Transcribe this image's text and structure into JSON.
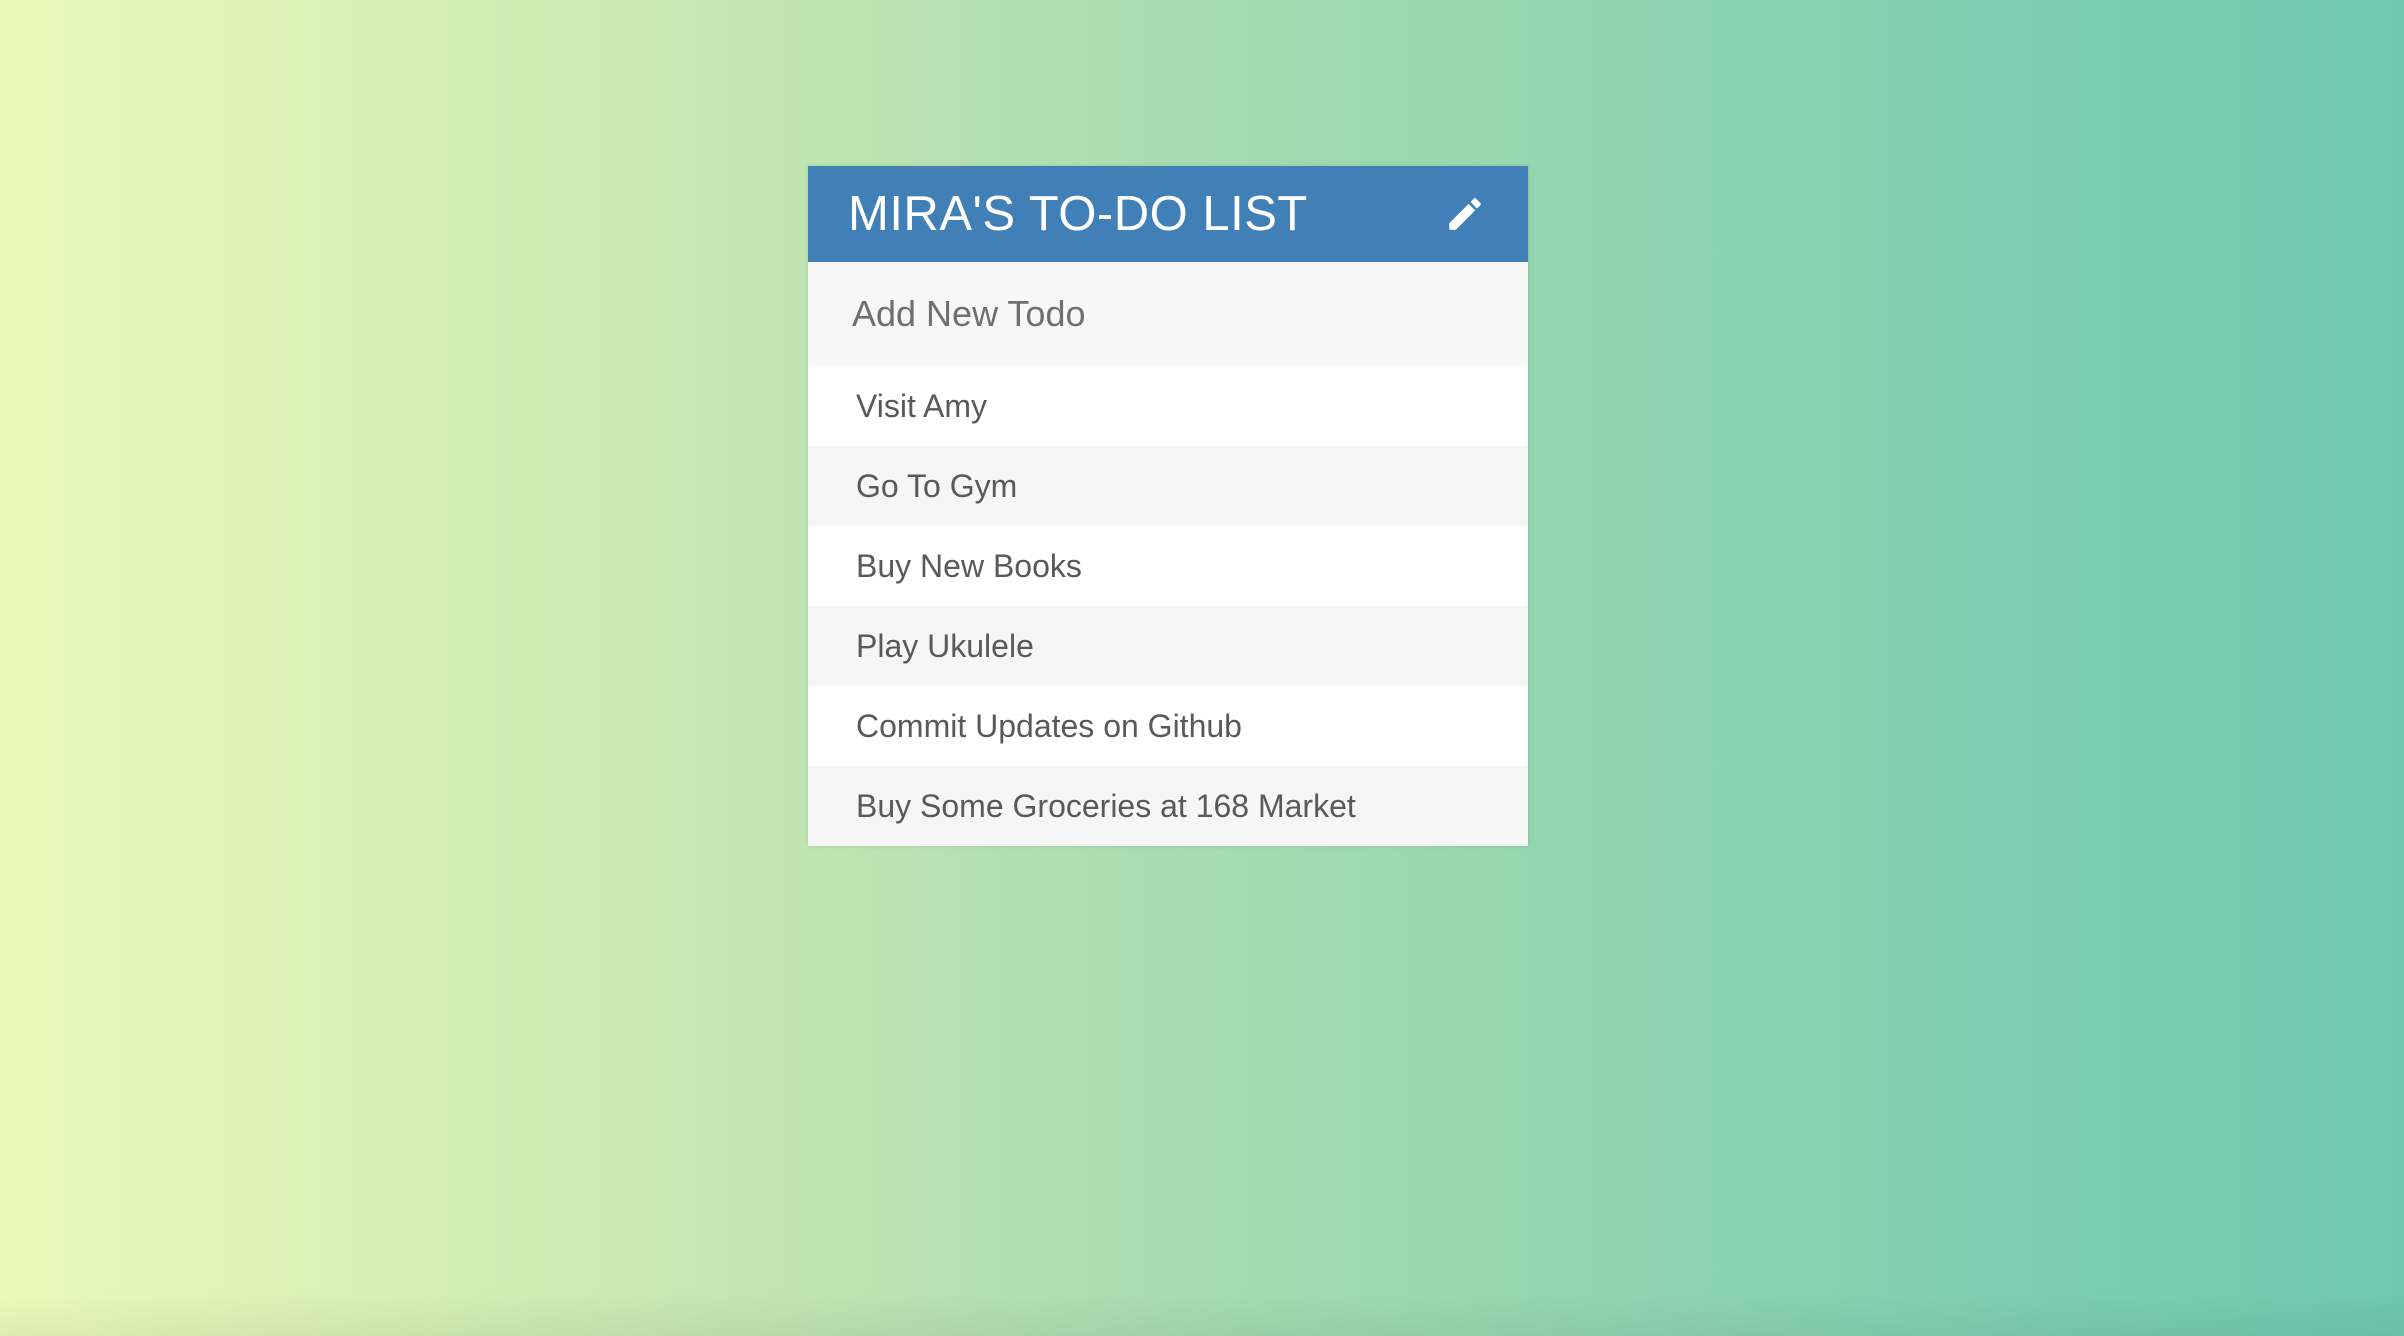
{
  "header": {
    "title": "MIRA'S TO-DO LIST",
    "edit_icon": "pencil-icon"
  },
  "new_todo": {
    "placeholder": "Add New Todo",
    "value": ""
  },
  "todos": [
    {
      "label": "Visit Amy"
    },
    {
      "label": "Go To Gym"
    },
    {
      "label": "Buy New Books"
    },
    {
      "label": "Play Ukulele"
    },
    {
      "label": "Commit Updates on Github"
    },
    {
      "label": "Buy Some Groceries at 168 Market"
    }
  ],
  "colors": {
    "header_bg": "#4180b7",
    "header_text": "#ffffff",
    "item_text": "#595959",
    "gradient_start": "#eafab8",
    "gradient_end": "#6fc8ae"
  }
}
